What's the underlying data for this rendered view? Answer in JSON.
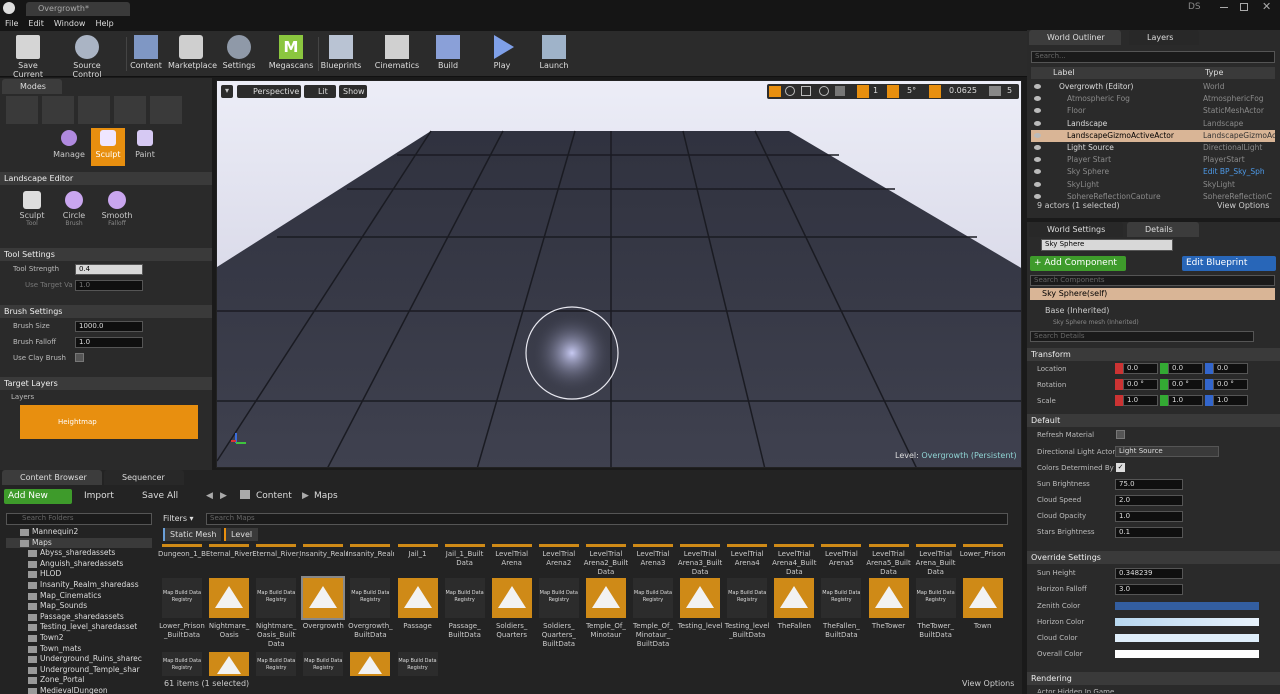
{
  "window": {
    "tab_title": "Overgrowth*",
    "user_initials": "DS"
  },
  "menu": [
    "File",
    "Edit",
    "Window",
    "Help"
  ],
  "toolbar": [
    {
      "label": "Save Current",
      "icon": "save-icon"
    },
    {
      "label": "Source Control",
      "icon": "source-control-icon"
    },
    {
      "label": "Content",
      "icon": "content-icon"
    },
    {
      "label": "Marketplace",
      "icon": "marketplace-icon"
    },
    {
      "label": "Settings",
      "icon": "gear-icon"
    },
    {
      "label": "Megascans",
      "icon": "megascans-icon"
    },
    {
      "label": "Blueprints",
      "icon": "blueprints-icon"
    },
    {
      "label": "Cinematics",
      "icon": "clapper-icon"
    },
    {
      "label": "Build",
      "icon": "build-icon"
    },
    {
      "label": "Play",
      "icon": "play-icon"
    },
    {
      "label": "Launch",
      "icon": "launch-icon"
    }
  ],
  "modes": {
    "tab": "Modes",
    "sub": [
      "Manage",
      "Sculpt",
      "Paint"
    ],
    "landscape_editor": "Landscape Editor",
    "tools": [
      {
        "name": "Sculpt",
        "sub": "Tool"
      },
      {
        "name": "Circle",
        "sub": "Brush"
      },
      {
        "name": "Smooth",
        "sub": "Falloff"
      }
    ],
    "tool_settings": {
      "title": "Tool Settings",
      "strength_label": "Tool Strength",
      "strength": "0.4",
      "target_label": "Use Target Va",
      "target": "1.0"
    },
    "brush_settings": {
      "title": "Brush Settings",
      "size_label": "Brush Size",
      "size": "1000.0",
      "falloff_label": "Brush Falloff",
      "falloff": "1.0",
      "clay_label": "Use Clay Brush"
    },
    "target_layers": {
      "title": "Target Layers",
      "layers_label": "Layers",
      "heightmap": "Heightmap"
    }
  },
  "viewport": {
    "perspective": "Perspective",
    "lit": "Lit",
    "show": "Show",
    "grid": "1",
    "angle": "5°",
    "scale": "0.0625",
    "cam": "5",
    "level_label": "Level:",
    "level_name": "Overgrowth (Persistent)"
  },
  "outliner": {
    "tab1": "World Outliner",
    "tab2": "Layers",
    "search": "Search...",
    "col_label": "Label",
    "col_type": "Type",
    "rows": [
      {
        "label": "Overgrowth (Editor)",
        "type": "World"
      },
      {
        "label": "Atmospheric Fog",
        "type": "AtmosphericFog"
      },
      {
        "label": "Floor",
        "type": "StaticMeshActor"
      },
      {
        "label": "Landscape",
        "type": "Landscape"
      },
      {
        "label": "LandscapeGizmoActiveActor",
        "type": "LandscapeGizmoAc"
      },
      {
        "label": "Light Source",
        "type": "DirectionalLight"
      },
      {
        "label": "Player Start",
        "type": "PlayerStart"
      },
      {
        "label": "Sky Sphere",
        "type": "Edit BP_Sky_Sph"
      },
      {
        "label": "SkyLight",
        "type": "SkyLight"
      },
      {
        "label": "SphereReflectionCapture",
        "type": "SphereReflectionC"
      }
    ],
    "status": "9 actors (1 selected)",
    "view_options": "View Options"
  },
  "details": {
    "tab1": "World Settings",
    "tab2": "Details",
    "name": "Sky Sphere",
    "add_component": "+ Add Component",
    "edit_blueprint": "Edit Blueprint",
    "search_components": "Search Components",
    "self": "Sky Sphere(self)",
    "base": "Base (Inherited)",
    "mesh": "Sky Sphere mesh (Inherited)",
    "search_details": "Search Details",
    "transform": "Transform",
    "location_label": "Location",
    "rotation_label": "Rotation",
    "scale_label": "Scale",
    "location": [
      "0.0",
      "0.0",
      "0.0"
    ],
    "rotation": [
      "0.0 °",
      "0.0 °",
      "0.0 °"
    ],
    "scale": [
      "1.0",
      "1.0",
      "1.0"
    ],
    "default": "Default",
    "refresh_material": "Refresh Material",
    "dir_light_label": "Directional Light Actor",
    "dir_light": "Light Source",
    "colors_determined": "Colors Determined By",
    "sun_brightness_label": "Sun Brightness",
    "sun_brightness": "75.0",
    "cloud_speed_label": "Cloud Speed",
    "cloud_speed": "2.0",
    "cloud_opacity_label": "Cloud Opacity",
    "cloud_opacity": "1.0",
    "stars_label": "Stars Brightness",
    "stars": "0.1",
    "override": "Override Settings",
    "sun_height_label": "Sun Height",
    "sun_height": "0.348239",
    "horizon_falloff_label": "Horizon Falloff",
    "horizon_falloff": "3.0",
    "zenith_label": "Zenith Color",
    "horizon_label": "Horizon Color",
    "cloud_color_label": "Cloud Color",
    "overall_label": "Overall Color",
    "rendering": "Rendering",
    "actor_hidden": "Actor Hidden In Game"
  },
  "content": {
    "tab1": "Content Browser",
    "tab2": "Sequencer",
    "add_new": "Add New",
    "import": "Import",
    "save_all": "Save All",
    "path": [
      "Content",
      "Maps"
    ],
    "search_folders": "Search Folders",
    "filters": "Filters",
    "search_maps": "Search Maps",
    "filter_chips": [
      "Static Mesh",
      "Level"
    ],
    "folders": [
      "Mannequin2",
      "Maps",
      "Abyss_sharedassets",
      "Anguish_sharedassets",
      "HLOD",
      "Insanity_Realm_sharedass",
      "Map_Cinematics",
      "Map_Sounds",
      "Passage_sharedassets",
      "Testing_level_sharedasset",
      "Town2",
      "Town_mats",
      "Underground_Ruins_sharec",
      "Underground_Temple_shar",
      "Zone_Portal",
      "MedievalDungeon"
    ],
    "top_labels": [
      "Dungeon_1_BuiltData",
      "Eternal_River",
      "Eternal_River_BuiltData",
      "Insanity_Realm",
      "Insanity_Realm_BuiltData",
      "Jail_1",
      "Jail_1_Built Data",
      "LevelTrial Arena",
      "LevelTrial Arena2",
      "LevelTrial Arena2_Built Data",
      "LevelTrial Arena3",
      "LevelTrial Arena3_Built Data",
      "LevelTrial Arena4",
      "LevelTrial Arena4_Built Data",
      "LevelTrial Arena5",
      "LevelTrial Arena5_Built Data",
      "LevelTrial Arena_Built Data",
      "Lower_Prison"
    ],
    "row2": [
      {
        "label": "Lower_Prison _BuiltData",
        "kind": "data"
      },
      {
        "label": "Nightmare_ Oasis",
        "kind": "map"
      },
      {
        "label": "Nightmare_ Oasis_Built Data",
        "kind": "data"
      },
      {
        "label": "Overgrowth",
        "kind": "map"
      },
      {
        "label": "Overgrowth_ BuiltData",
        "kind": "data"
      },
      {
        "label": "Passage",
        "kind": "map"
      },
      {
        "label": "Passage_ BuiltData",
        "kind": "data"
      },
      {
        "label": "Soldiers_ Quarters",
        "kind": "map"
      },
      {
        "label": "Soldiers_ Quarters_ BuiltData",
        "kind": "data"
      },
      {
        "label": "Temple_Of_ Minotaur",
        "kind": "map"
      },
      {
        "label": "Temple_Of_ Minotaur_ BuiltData",
        "kind": "data"
      },
      {
        "label": "Testing_level",
        "kind": "map"
      },
      {
        "label": "Testing_level _BuiltData",
        "kind": "data"
      },
      {
        "label": "TheFallen",
        "kind": "map"
      },
      {
        "label": "TheFallen_ BuiltData",
        "kind": "data"
      },
      {
        "label": "TheTower",
        "kind": "map"
      },
      {
        "label": "TheTower_ BuiltData",
        "kind": "data"
      },
      {
        "label": "Town",
        "kind": "map"
      }
    ],
    "row3": [
      "data",
      "map",
      "data",
      "data",
      "map",
      "data"
    ],
    "data_thumb_text": "Map Build Data Registry",
    "status": "61 items (1 selected)",
    "view_options": "View Options"
  },
  "colors": {
    "accent": "#e88f0f",
    "green": "#3e9b2b",
    "blue": "#2866b8"
  }
}
